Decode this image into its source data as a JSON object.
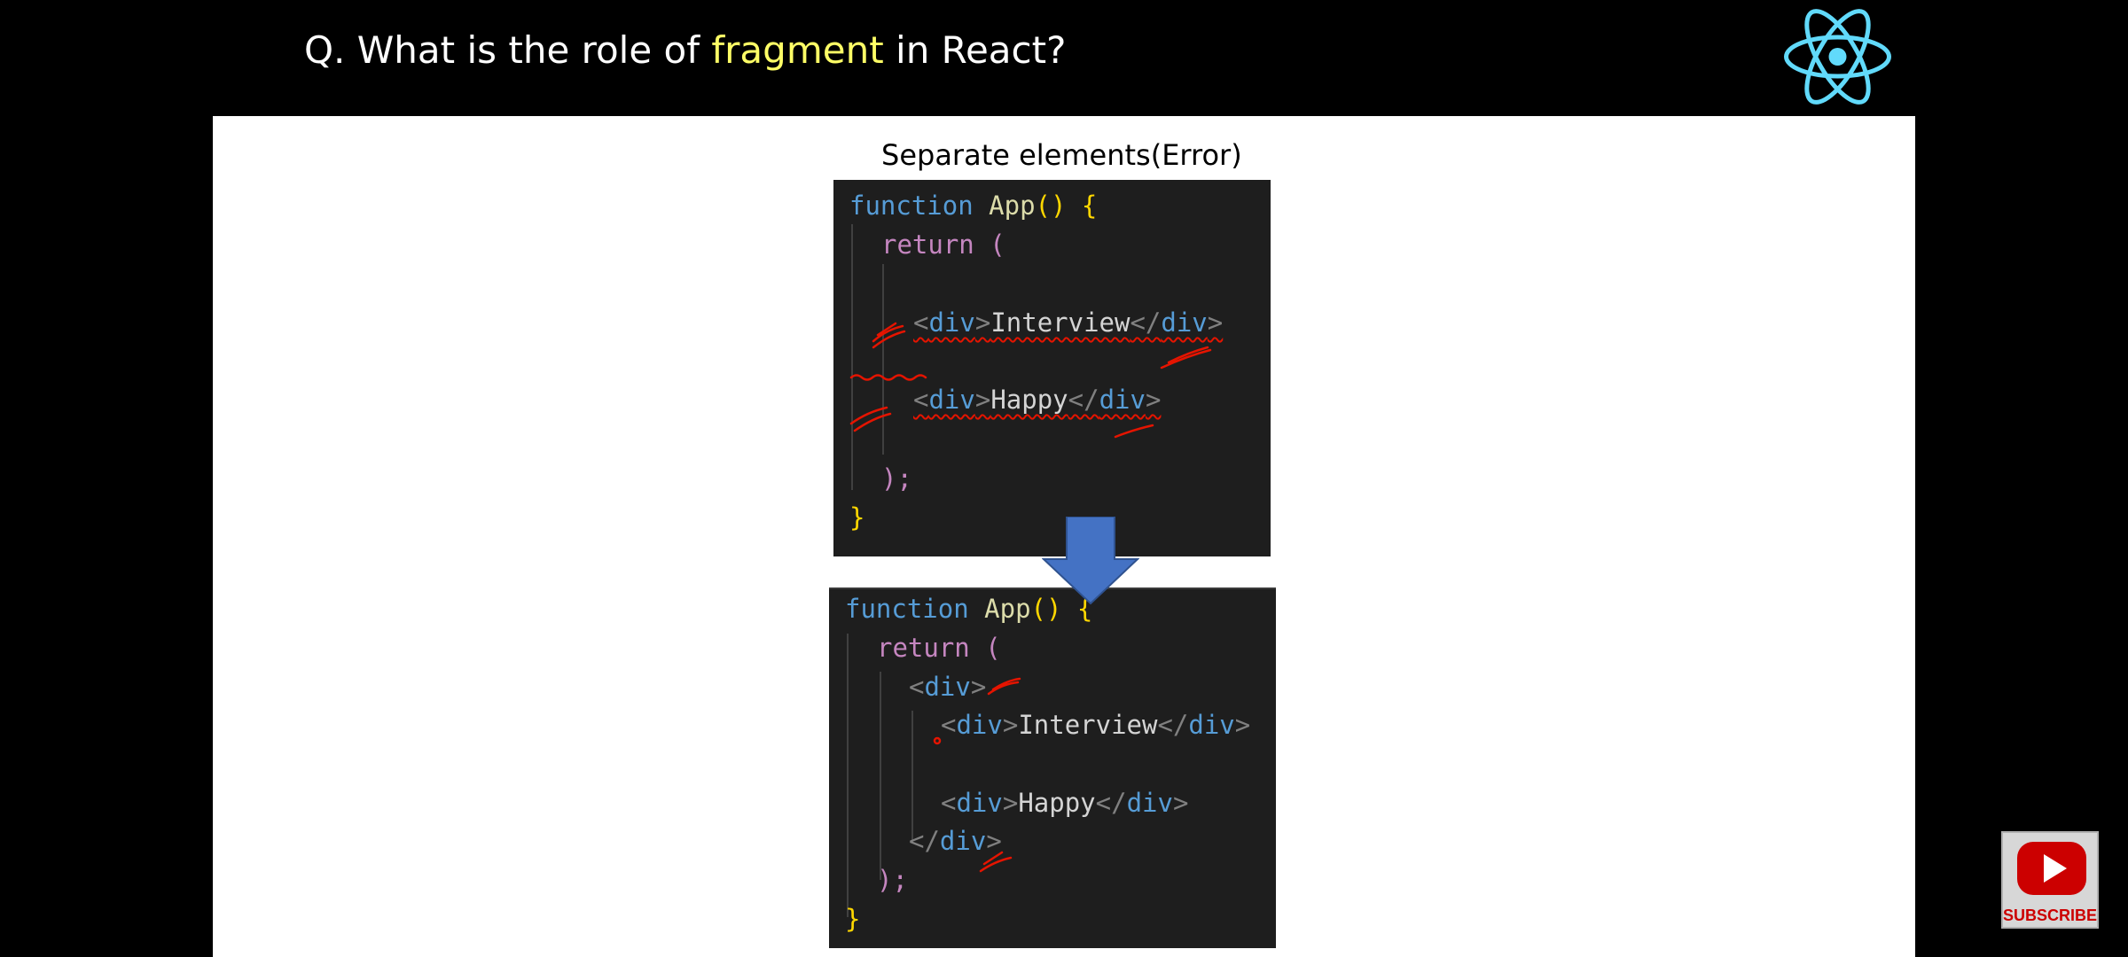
{
  "header": {
    "title_prefix": "Q. What is the role of ",
    "title_highlight": "fragment",
    "title_suffix": " in React?"
  },
  "slide": {
    "caption": "Separate elements(Error)"
  },
  "code_error": {
    "l1_kw": "function",
    "l1_fn": "App",
    "l1_br": "() {",
    "l2_ret": "return",
    "l2_br": "(",
    "l3_text": "Interview",
    "l4_text": "Happy",
    "tag": "div",
    "l5_close": ");",
    "l6_close": "}"
  },
  "code_fixed": {
    "l1_kw": "function",
    "l1_fn": "App",
    "l1_br": "() {",
    "l2_ret": "return",
    "l2_br": "(",
    "l4_text": "Interview",
    "l5_text": "Happy",
    "tag": "div",
    "l7_close": ");",
    "l8_close": "}"
  },
  "subscribe": {
    "label": "SUBSCRIBE"
  },
  "colors": {
    "accent": "#ffff66",
    "react": "#61dafb",
    "arrow": "#4472c4"
  }
}
